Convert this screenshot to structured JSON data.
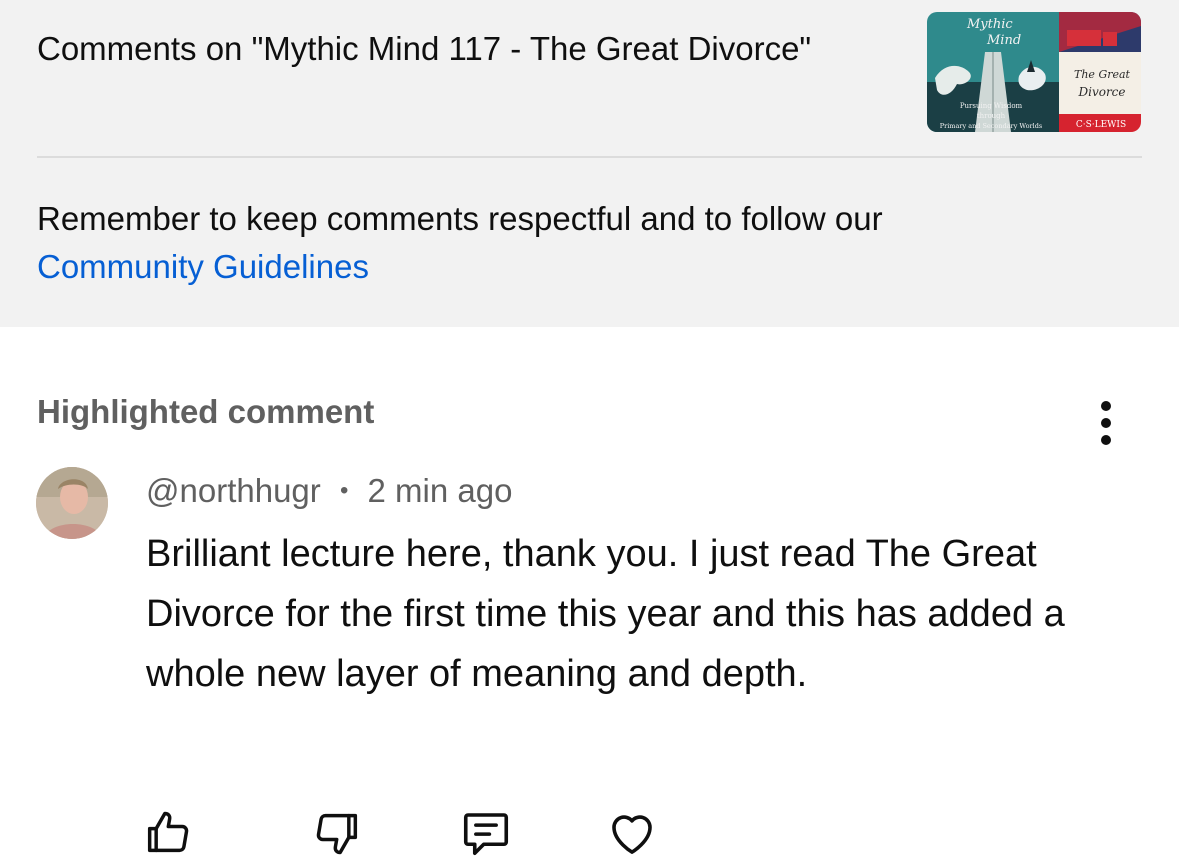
{
  "header": {
    "title": "Comments on \"Mythic Mind 117 - The Great Divorce\"",
    "thumbnail": {
      "left_title_line1": "Mythic",
      "left_title_line2": "Mind",
      "left_caption_line1": "Pursuing Wisdom",
      "left_caption_line2": "through",
      "left_caption_line3": "Primary and Secondary Worlds",
      "right_title_line1": "The Great",
      "right_title_line2": "Divorce",
      "right_author": "C·S·LEWIS"
    }
  },
  "guidelines": {
    "text": "Remember to keep comments respectful and to follow our",
    "link": "Community Guidelines"
  },
  "highlighted": {
    "label": "Highlighted comment",
    "more_icon": "more-vert-icon"
  },
  "comment": {
    "author": "@northhugr",
    "separator": "•",
    "time": "2 min ago",
    "text": "Brilliant lecture here, thank you. I just read The Great Divorce for the first time this year and this has added a whole new layer of meaning and depth."
  },
  "actions": {
    "icons": [
      "thumbs-up-icon",
      "thumbs-down-icon",
      "reply-icon",
      "heart-icon"
    ]
  },
  "colors": {
    "panel_bg": "#f2f2f2",
    "link": "#065fd4",
    "secondary_text": "#606060",
    "primary_text": "#0f0f0f"
  }
}
